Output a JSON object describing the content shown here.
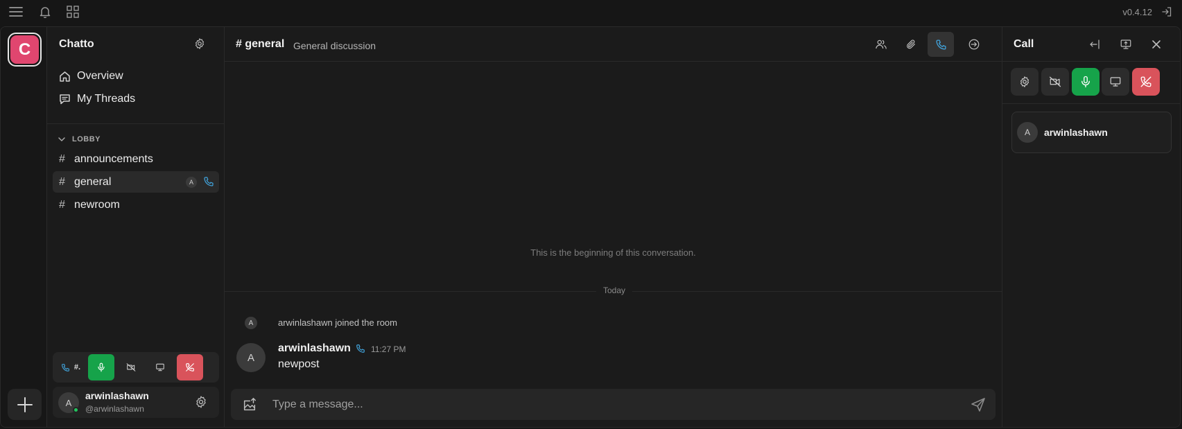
{
  "app": {
    "version": "v0.4.12"
  },
  "server": {
    "initial": "C",
    "name": "Chatto"
  },
  "sidebar": {
    "nav": [
      {
        "label": "Overview",
        "icon": "home-icon"
      },
      {
        "label": "My Threads",
        "icon": "threads-icon"
      }
    ],
    "section_label": "LOBBY",
    "channels": [
      {
        "name": "announcements",
        "active": false
      },
      {
        "name": "general",
        "active": true,
        "participant_initial": "A",
        "in_call": true
      },
      {
        "name": "newroom",
        "active": false
      }
    ],
    "voice_bar": {
      "channel_abbrev": "#.",
      "mic_on": true,
      "camera_on": false
    },
    "user": {
      "initial": "A",
      "name": "arwinlashawn",
      "handle": "@arwinlashawn",
      "status": "online"
    }
  },
  "chat": {
    "channel_title": "# general",
    "description": "General discussion",
    "beginning_text": "This is the beginning of this conversation.",
    "day_label": "Today",
    "system_message": {
      "initial": "A",
      "text": "arwinlashawn joined the room"
    },
    "message": {
      "initial": "A",
      "author": "arwinlashawn",
      "time": "11:27 PM",
      "text": "newpost"
    },
    "composer_placeholder": "Type a message..."
  },
  "call": {
    "title": "Call",
    "participants": [
      {
        "initial": "A",
        "name": "arwinlashawn"
      }
    ]
  },
  "colors": {
    "accent_blue": "#41a5de",
    "mic_green": "#16a34a",
    "hangup_red": "#d9535b",
    "server_pink": "#e0466f",
    "online": "#22c55e"
  }
}
